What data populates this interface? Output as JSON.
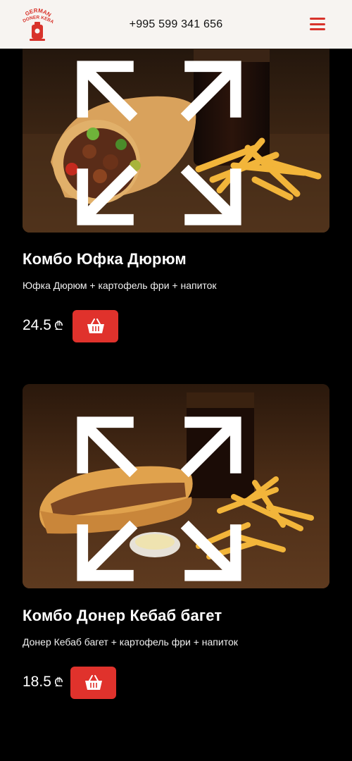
{
  "header": {
    "phone": "+995 599 341 656",
    "logo_text": [
      "GERMAN",
      "DONER KEBAB"
    ],
    "menu_icon": "hamburger-menu-icon",
    "accent_color": "#d8332b"
  },
  "products": [
    {
      "title": "Комбо Юфка Дюрюм",
      "description": "Юфка Дюрюм + картофель фри + напиток",
      "price": "24.5",
      "currency": "₾",
      "image": "wrap, fries and cola on wooden table",
      "expand_icon": "expand-icon",
      "cart_icon": "basket-icon"
    },
    {
      "title": "Комбо Донер Кебаб багет",
      "description": "Донер Кебаб багет + картофель фри + напиток",
      "price": "18.5",
      "currency": "₾",
      "image": "baguette, sauce, fries and cola on wooden table",
      "expand_icon": "expand-icon",
      "cart_icon": "basket-icon"
    }
  ],
  "colors": {
    "button": "#e0322c",
    "background": "#000000",
    "header_bg": "#f7f4f1"
  }
}
